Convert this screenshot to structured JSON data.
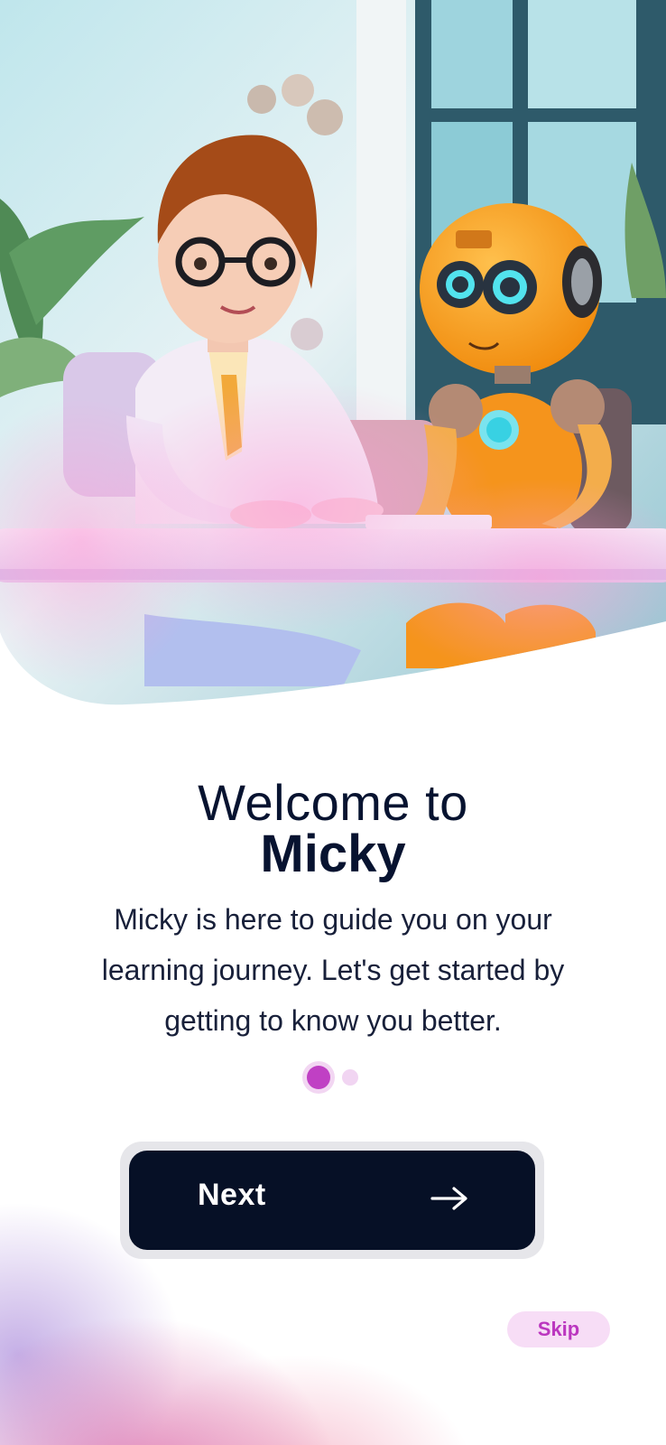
{
  "onboarding": {
    "title_line1": "Welcome to",
    "title_line2": "Micky",
    "description": "Micky is here to guide you on your learning journey. Let's get started by getting to know you better.",
    "page_indicator": {
      "current": 1,
      "total": 2
    },
    "next_label": "Next",
    "next_icon": "arrow-right-icon",
    "skip_label": "Skip"
  },
  "colors": {
    "accent": "#C040C4",
    "button_bg": "#061026",
    "skip_bg": "#F7DDF6",
    "title": "#071330"
  }
}
